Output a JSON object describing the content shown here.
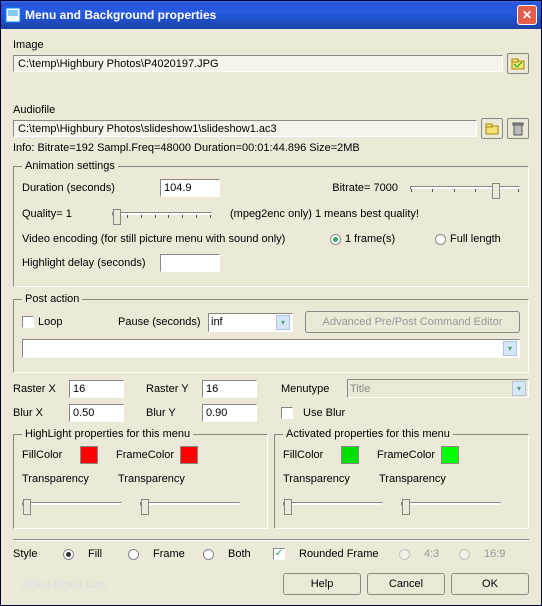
{
  "window": {
    "title": "Menu and Background properties"
  },
  "image": {
    "label": "Image",
    "path": "C:\\temp\\Highbury Photos\\P4020197.JPG"
  },
  "audio": {
    "label": "Audiofile",
    "path": "C:\\temp\\Highbury Photos\\slideshow1\\slideshow1.ac3",
    "info": "Info: Bitrate=192  Sampl.Freq=48000   Duration=00:01:44.896  Size=2MB"
  },
  "anim": {
    "legend": "Animation settings",
    "duration_label": "Duration (seconds)",
    "duration_value": "104.9",
    "bitrate_label": "Bitrate= 7000",
    "quality_label": "Quality= 1",
    "quality_note": "(mpeg2enc only) 1 means best quality!",
    "video_enc_label": "Video encoding (for still picture menu with sound only)",
    "frame_opt": "1 frame(s)",
    "full_opt": "Full length",
    "hl_delay_label": "Highlight delay (seconds)",
    "hl_delay_value": ""
  },
  "post": {
    "legend": "Post action",
    "loop_label": "Loop",
    "pause_label": "Pause (seconds)",
    "pause_value": "inf",
    "adv_btn": "Advanced Pre/Post Command Editor",
    "command_value": ""
  },
  "raster": {
    "raster_x_label": "Raster X",
    "raster_x": "16",
    "raster_y_label": "Raster Y",
    "raster_y": "16",
    "menutype_label": "Menutype",
    "menutype": "Title",
    "blur_x_label": "Blur X",
    "blur_x": "0.50",
    "blur_y_label": "Blur Y",
    "blur_y": "0.90",
    "use_blur_label": "Use Blur"
  },
  "hl_props": {
    "legend": "HighLight properties for this menu",
    "fill_label": "FillColor",
    "fill_color": "#ff0000",
    "frame_label": "FrameColor",
    "frame_color": "#ff0000",
    "trans_label": "Transparency"
  },
  "act_props": {
    "legend": "Activated properties for this menu",
    "fill_label": "FillColor",
    "fill_color": "#00e000",
    "frame_label": "FrameColor",
    "frame_color": "#00ff00",
    "trans_label": "Transparency"
  },
  "style": {
    "label": "Style",
    "fill": "Fill",
    "frame": "Frame",
    "both": "Both",
    "rounded": "Rounded Frame",
    "ar43": "4:3",
    "ar169": "16:9"
  },
  "buttons": {
    "help": "Help",
    "cancel": "Cancel",
    "ok": "OK"
  },
  "watermark": "digital-digest.com"
}
